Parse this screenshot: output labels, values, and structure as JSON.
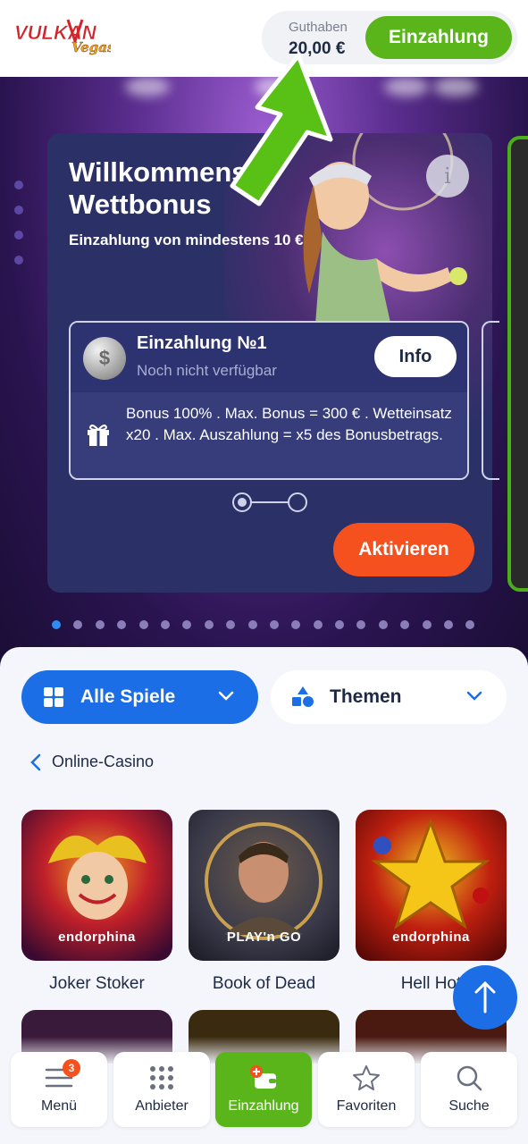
{
  "header": {
    "logo_text": "VULKAN Vegas",
    "balance_label": "Guthaben",
    "balance_value": "20,00 €",
    "deposit_label": "Einzahlung"
  },
  "bonus_card": {
    "title": "Willkommens\nWettbonus",
    "subtitle": "Einzahlung von mindestens 10 €",
    "info_icon": "info-icon",
    "deposit": {
      "title": "Einzahlung №1",
      "status": "Noch nicht verfügbar",
      "info_button": "Info",
      "description": "Bonus 100% . Max. Bonus = 300 € . Wetteinsatz x20 . Max. Auszahlung = x5 des Bonusbetrags."
    },
    "activate_label": "Aktivieren"
  },
  "carousel": {
    "total": 20,
    "active_index": 0
  },
  "categories": {
    "all_games_label": "Alle Spiele",
    "themes_label": "Themen"
  },
  "breadcrumb": {
    "label": "Online-Casino"
  },
  "games": [
    {
      "name": "Joker Stoker",
      "provider": "endorphina"
    },
    {
      "name": "Book of Dead",
      "provider": "PLAY'n GO"
    },
    {
      "name": "Hell Hot",
      "provider": "endorphina"
    }
  ],
  "bottom_nav": [
    {
      "label": "Menü",
      "badge": "3",
      "icon": "menu-icon"
    },
    {
      "label": "Anbieter",
      "icon": "grid-icon"
    },
    {
      "label": "Einzahlung",
      "icon": "wallet-plus-icon"
    },
    {
      "label": "Favoriten",
      "icon": "star-icon"
    },
    {
      "label": "Suche",
      "icon": "search-icon"
    }
  ],
  "colors": {
    "brand_green": "#59b51a",
    "primary_blue": "#1b6ee6",
    "accent_orange": "#f4511e",
    "card_navy": "#2b3067"
  }
}
